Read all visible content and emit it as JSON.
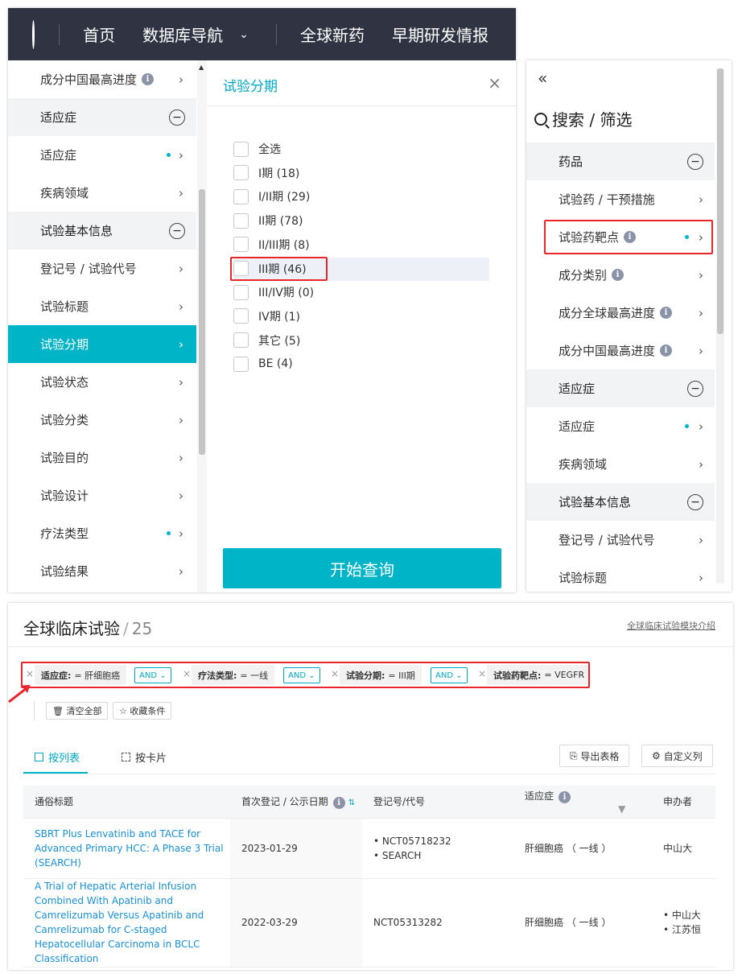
{
  "nav": {
    "items": [
      "首页",
      "数据库导航",
      "全球新药",
      "早期研发情报"
    ],
    "dropdown_glyph": "⌄",
    "logo_icon": "logo-icon"
  },
  "left_sidebar": {
    "items": [
      {
        "label": "成分中国最高进度",
        "type": "item",
        "info": true
      },
      {
        "label": "适应症",
        "type": "group"
      },
      {
        "label": "适应症",
        "type": "item",
        "dot": true
      },
      {
        "label": "疾病领域",
        "type": "item"
      },
      {
        "label": "试验基本信息",
        "type": "group"
      },
      {
        "label": "登记号 / 试验代号",
        "type": "item"
      },
      {
        "label": "试验标题",
        "type": "item"
      },
      {
        "label": "试验分期",
        "type": "item",
        "active": true
      },
      {
        "label": "试验状态",
        "type": "item"
      },
      {
        "label": "试验分类",
        "type": "item"
      },
      {
        "label": "试验目的",
        "type": "item"
      },
      {
        "label": "试验设计",
        "type": "item"
      },
      {
        "label": "疗法类型",
        "type": "item",
        "dot": true
      },
      {
        "label": "试验结果",
        "type": "item"
      }
    ]
  },
  "stage_panel": {
    "title": "试验分期",
    "close_glyph": "×",
    "options": [
      "全选",
      "I期 (18)",
      "I/II期 (29)",
      "II期 (78)",
      "II/III期 (8)",
      "III期 (46)",
      "III/IV期 (0)",
      "IV期 (1)",
      "其它 (5)",
      "BE (4)"
    ],
    "highlighted_index": 5,
    "query_button": "开始查询"
  },
  "right_panel": {
    "collapse_glyph": "«",
    "search_title": "搜索 / 筛选",
    "items": [
      {
        "label": "药品",
        "type": "group"
      },
      {
        "label": "试验药 / 干预措施",
        "type": "item"
      },
      {
        "label": "试验药靶点",
        "type": "item",
        "info": true,
        "dot": true
      },
      {
        "label": "成分类别",
        "type": "item",
        "info": true
      },
      {
        "label": "成分全球最高进度",
        "type": "item",
        "info": true
      },
      {
        "label": "成分中国最高进度",
        "type": "item",
        "info": true
      },
      {
        "label": "适应症",
        "type": "group"
      },
      {
        "label": "适应症",
        "type": "item",
        "dot": true
      },
      {
        "label": "疾病领域",
        "type": "item"
      },
      {
        "label": "试验基本信息",
        "type": "group"
      },
      {
        "label": "登记号 / 试验代号",
        "type": "item"
      },
      {
        "label": "试验标题",
        "type": "item"
      }
    ]
  },
  "results": {
    "title": "全球临床试验",
    "separator": "/",
    "count": "25",
    "intro_link": "全球临床试验模块介绍",
    "filters": [
      {
        "key": "适应症:",
        "value": "= 肝细胞癌"
      },
      {
        "key": "疗法类型:",
        "value": "= 一线"
      },
      {
        "key": "试验分期:",
        "value": "= III期"
      },
      {
        "key": "试验药靶点:",
        "value": "= VEGFR"
      }
    ],
    "and_label": "AND",
    "clear_all": "清空全部",
    "save_conditions": "收藏条件",
    "tabs": [
      "按列表",
      "按卡片"
    ],
    "export": "导出表格",
    "custom_columns": "自定义列",
    "columns": [
      "通俗标题",
      "首次登记 / 公示日期",
      "登记号/代号",
      "适应症",
      "申办者"
    ],
    "rows": [
      {
        "title": "SBRT Plus Lenvatinib and TACE for Advanced Primary HCC: A Phase 3 Trial (SEARCH)",
        "date": "2023-01-29",
        "ids": [
          "• NCT05718232",
          "• SEARCH"
        ],
        "indication": "肝细胞癌 （ 一线 ）",
        "sponsor": [
          "中山大"
        ]
      },
      {
        "title": "A Trial of Hepatic Arterial Infusion Combined With Apatinib and Camrelizumab Versus Apatinib and Camrelizumab for C-staged Hepatocellular Carcinoma in BCLC Classification",
        "date": "2022-03-29",
        "ids": [
          "NCT05313282"
        ],
        "indication": "肝细胞癌 （ 一线 ）",
        "sponsor": [
          "• 中山大",
          "• 江苏恒"
        ]
      }
    ]
  },
  "colors": {
    "accent": "#00b4c8",
    "nav_bg": "#2f3342",
    "highlight_red": "#e8262b",
    "link": "#1a8fd6"
  }
}
